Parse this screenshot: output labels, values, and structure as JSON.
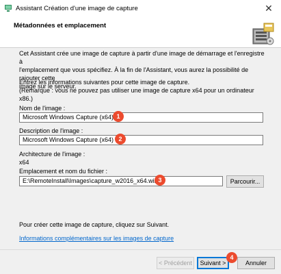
{
  "window": {
    "title": "Assistant Création d'une image de capture",
    "close_glyph": "✕"
  },
  "header": {
    "title": "Métadonnées et emplacement"
  },
  "content": {
    "intro_line1": "Cet Assistant crée une image de capture à partir d'une image de démarrage et l'enregistre à",
    "intro_line2": "l'emplacement que vous spécifiez. À la fin de l'Assistant, vous aurez la possibilité de rajouter cette",
    "intro_line3": "image sur le serveur.",
    "instr_line1": "Entrez les informations suivantes pour cette image de capture.",
    "instr_line2": "(Remarque : vous ne pouvez pas utiliser une image de capture x64 pour un ordinateur x86.)",
    "image_name_label": "Nom de l'image :",
    "image_name_value": "Microsoft Windows Capture (x64)",
    "description_label": "Description de l'image :",
    "description_value": "Microsoft Windows Capture (x64)",
    "arch_label": "Architecture de l'image :",
    "arch_value": "x64",
    "location_label": "Emplacement et nom du fichier :",
    "location_value": "E:\\RemoteInstall\\Images\\capture_w2016_x64.wim",
    "browse_label": "Parcourir...",
    "bottom_text": "Pour créer cette image de capture, cliquez sur Suivant.",
    "link_text": "Informations complémentaires sur les images de capture"
  },
  "badges": [
    "1",
    "2",
    "3",
    "4"
  ],
  "footer": {
    "prev_label": "< Précédent",
    "next_label": "Suivant >",
    "cancel_label": "Annuler"
  },
  "colors": {
    "badge": "#ec4b2e",
    "link": "#0066cc",
    "accent": "#0078d7"
  }
}
